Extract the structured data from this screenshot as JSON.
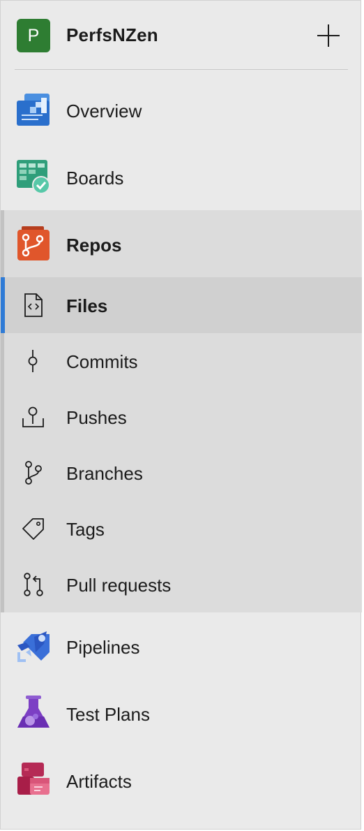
{
  "project": {
    "initial": "P",
    "name": "PerfsNZen",
    "avatar_color": "#2e7d32"
  },
  "nav": {
    "overview": "Overview",
    "boards": "Boards",
    "repos": "Repos",
    "repos_children": {
      "files": "Files",
      "commits": "Commits",
      "pushes": "Pushes",
      "branches": "Branches",
      "tags": "Tags",
      "pull_requests": "Pull requests"
    },
    "pipelines": "Pipelines",
    "test_plans": "Test Plans",
    "artifacts": "Artifacts"
  },
  "selected_item": "Files",
  "accent_color": "#2f7bd6",
  "icons": {
    "add": "plus-icon",
    "overview": "overview-icon",
    "boards": "boards-icon",
    "repos": "repos-icon",
    "files": "file-code-icon",
    "commits": "commit-icon",
    "pushes": "push-icon",
    "branches": "branch-icon",
    "tags": "tag-icon",
    "pull_requests": "pull-request-icon",
    "pipelines": "pipelines-icon",
    "test_plans": "test-plans-icon",
    "artifacts": "artifacts-icon"
  }
}
